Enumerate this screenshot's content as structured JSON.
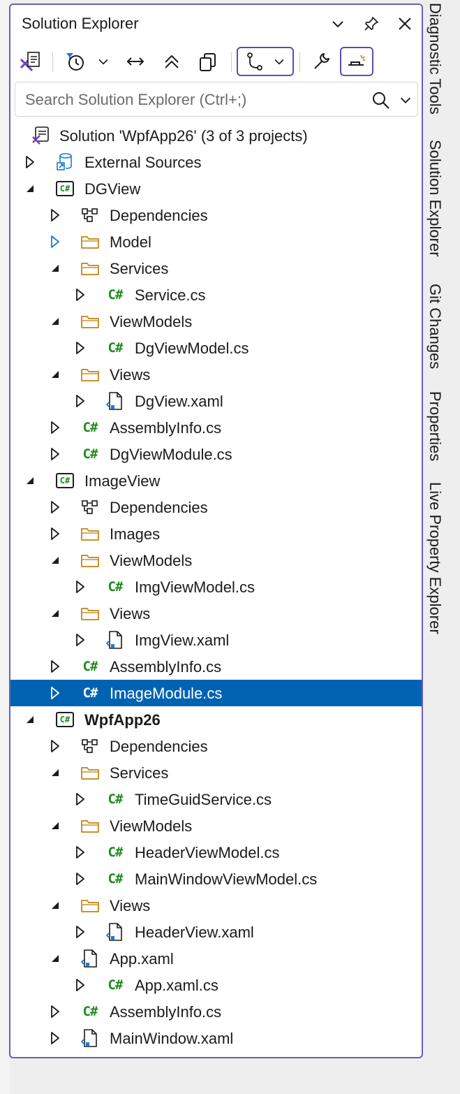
{
  "panel": {
    "title": "Solution Explorer"
  },
  "search": {
    "placeholder": "Search Solution Explorer (Ctrl+;)"
  },
  "tree": [
    {
      "label": "Solution 'WpfApp26' (3 of 3 projects)",
      "icon": "solution-icon",
      "level": 0,
      "expander": "none"
    },
    {
      "label": "External Sources",
      "icon": "external-sources-icon",
      "level": 0,
      "expander": "collapsed"
    },
    {
      "label": "DGView",
      "icon": "csharp-project-icon",
      "level": 0,
      "expander": "expanded"
    },
    {
      "label": "Dependencies",
      "icon": "dependencies-icon",
      "level": 1,
      "expander": "collapsed"
    },
    {
      "label": "Model",
      "icon": "folder-icon",
      "level": 1,
      "expander": "collapsed-blue"
    },
    {
      "label": "Services",
      "icon": "folder-icon",
      "level": 1,
      "expander": "expanded"
    },
    {
      "label": "Service.cs",
      "icon": "csharp-file-icon",
      "level": 2,
      "expander": "collapsed"
    },
    {
      "label": "ViewModels",
      "icon": "folder-icon",
      "level": 1,
      "expander": "expanded"
    },
    {
      "label": "DgViewModel.cs",
      "icon": "csharp-file-icon",
      "level": 2,
      "expander": "collapsed"
    },
    {
      "label": "Views",
      "icon": "folder-icon",
      "level": 1,
      "expander": "expanded"
    },
    {
      "label": "DgView.xaml",
      "icon": "xaml-file-icon",
      "level": 2,
      "expander": "collapsed"
    },
    {
      "label": "AssemblyInfo.cs",
      "icon": "csharp-file-icon",
      "level": 1,
      "expander": "collapsed"
    },
    {
      "label": "DgViewModule.cs",
      "icon": "csharp-file-icon",
      "level": 1,
      "expander": "collapsed"
    },
    {
      "label": "ImageView",
      "icon": "csharp-project-icon",
      "level": 0,
      "expander": "expanded"
    },
    {
      "label": "Dependencies",
      "icon": "dependencies-icon",
      "level": 1,
      "expander": "collapsed"
    },
    {
      "label": "Images",
      "icon": "folder-icon",
      "level": 1,
      "expander": "collapsed"
    },
    {
      "label": "ViewModels",
      "icon": "folder-icon",
      "level": 1,
      "expander": "expanded"
    },
    {
      "label": "ImgViewModel.cs",
      "icon": "csharp-file-icon",
      "level": 2,
      "expander": "collapsed"
    },
    {
      "label": "Views",
      "icon": "folder-icon",
      "level": 1,
      "expander": "expanded"
    },
    {
      "label": "ImgView.xaml",
      "icon": "xaml-file-icon",
      "level": 2,
      "expander": "collapsed"
    },
    {
      "label": "AssemblyInfo.cs",
      "icon": "csharp-file-icon",
      "level": 1,
      "expander": "collapsed"
    },
    {
      "label": "ImageModule.cs",
      "icon": "csharp-file-icon",
      "level": 1,
      "expander": "collapsed",
      "selected": true
    },
    {
      "label": "WpfApp26",
      "icon": "csharp-project-icon",
      "level": 0,
      "expander": "expanded",
      "bold": true
    },
    {
      "label": "Dependencies",
      "icon": "dependencies-icon",
      "level": 1,
      "expander": "collapsed"
    },
    {
      "label": "Services",
      "icon": "folder-icon",
      "level": 1,
      "expander": "expanded"
    },
    {
      "label": "TimeGuidService.cs",
      "icon": "csharp-file-icon",
      "level": 2,
      "expander": "collapsed"
    },
    {
      "label": "ViewModels",
      "icon": "folder-icon",
      "level": 1,
      "expander": "expanded"
    },
    {
      "label": "HeaderViewModel.cs",
      "icon": "csharp-file-icon",
      "level": 2,
      "expander": "collapsed"
    },
    {
      "label": "MainWindowViewModel.cs",
      "icon": "csharp-file-icon",
      "level": 2,
      "expander": "collapsed"
    },
    {
      "label": "Views",
      "icon": "folder-icon",
      "level": 1,
      "expander": "expanded"
    },
    {
      "label": "HeaderView.xaml",
      "icon": "xaml-file-icon",
      "level": 2,
      "expander": "collapsed"
    },
    {
      "label": "App.xaml",
      "icon": "xaml-file-icon",
      "level": 1,
      "expander": "expanded"
    },
    {
      "label": "App.xaml.cs",
      "icon": "csharp-file-icon",
      "level": 2,
      "expander": "collapsed"
    },
    {
      "label": "AssemblyInfo.cs",
      "icon": "csharp-file-icon",
      "level": 1,
      "expander": "collapsed"
    },
    {
      "label": "MainWindow.xaml",
      "icon": "xaml-file-icon",
      "level": 1,
      "expander": "collapsed"
    }
  ],
  "side_tabs": [
    "Diagnostic Tools",
    "Solution Explorer",
    "Git Changes",
    "Properties",
    "Live Property Explorer"
  ],
  "colors": {
    "accent": "#6a5fb7",
    "selection": "#0063b1",
    "csharp_green": "#1f8a1f",
    "folder": "#c8922e",
    "link_blue": "#1a7bd6"
  }
}
